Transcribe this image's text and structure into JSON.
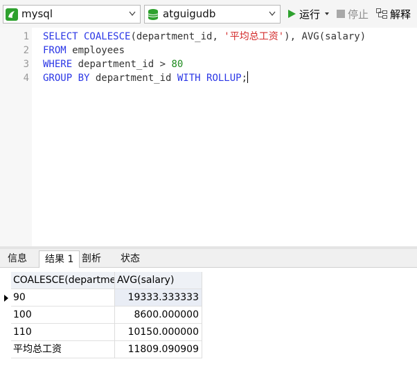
{
  "toolbar": {
    "connection": "mysql",
    "database": "atguigudb",
    "run_label": "运行",
    "stop_label": "停止",
    "explain_label": "解释"
  },
  "editor": {
    "line_numbers": [
      "1",
      "2",
      "3",
      "4"
    ],
    "lines": [
      [
        {
          "t": "SELECT COALESCE",
          "k": "kw"
        },
        {
          "t": "(department_id, ",
          "k": "plain"
        },
        {
          "t": "'平均总工资'",
          "k": "str"
        },
        {
          "t": "), AVG(salary)",
          "k": "plain"
        }
      ],
      [
        {
          "t": "FROM",
          "k": "kw"
        },
        {
          "t": " employees",
          "k": "plain"
        }
      ],
      [
        {
          "t": "WHERE",
          "k": "kw"
        },
        {
          "t": " department_id > ",
          "k": "plain"
        },
        {
          "t": "80",
          "k": "num"
        }
      ],
      [
        {
          "t": "GROUP BY",
          "k": "kw"
        },
        {
          "t": " department_id ",
          "k": "plain"
        },
        {
          "t": "WITH ROLLUP",
          "k": "kw"
        },
        {
          "t": ";",
          "k": "plain"
        }
      ]
    ]
  },
  "tabs": [
    "信息",
    "结果 1",
    "剖析",
    "状态"
  ],
  "active_tab": "结果 1",
  "results": {
    "columns": [
      "COALESCE(department_id, '平均总工资')",
      "AVG(salary)"
    ],
    "rows": [
      [
        "90",
        "19333.333333"
      ],
      [
        "100",
        "8600.000000"
      ],
      [
        "110",
        "10150.000000"
      ],
      [
        "平均总工资",
        "11809.090909"
      ]
    ]
  },
  "colors": {
    "keyword": "#2a36e6",
    "string": "#d32b2b",
    "number": "#1d8a1d",
    "run_icon": "#2ea12e"
  },
  "icons": [
    "mysql-connection-icon",
    "database-icon",
    "chevron-down-icon",
    "run-icon",
    "stop-icon",
    "explain-icon",
    "row-pointer-icon"
  ]
}
